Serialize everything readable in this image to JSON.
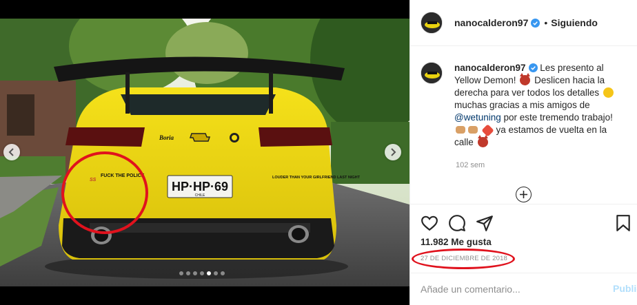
{
  "post": {
    "username": "nanocalderon97",
    "separator": "•",
    "follow_status": "Siguiendo",
    "plate_text": "HP·HP·69",
    "plate_country": "CHILE",
    "badge_text": "SS",
    "decal_left": "FUCK THE POLICE",
    "decal_right": "LOUDER THAN YOUR GIRLFRIEND LAST NIGHT",
    "brand_badge": "Boria",
    "photo_count": 7,
    "active_photo": 5
  },
  "caption": {
    "username": "nanocalderon97",
    "text_1": "Les presento al Yellow Demon!",
    "text_2": "Deslicen hacia la derecha para ver todos los detalles",
    "text_3": "muchas gracias a mis amigos de",
    "mention": "@wetuning",
    "text_4": "por este tremendo trabajo!",
    "text_5": "ya estamos de vuelta en la calle",
    "time": "102 sem",
    "emojis": [
      "smiling-devil",
      "star-struck",
      "fist-bump",
      "fist-bump",
      "collision",
      "smiling-devil"
    ]
  },
  "stats": {
    "likes": "11.982 Me gusta",
    "date": "27 DE DICIEMBRE DE 2018"
  },
  "comment": {
    "placeholder": "Añade un comentario...",
    "post_label": "Publicar"
  },
  "icons": [
    "heart-icon",
    "comment-icon",
    "share-icon",
    "bookmark-icon",
    "plus-circle-icon",
    "verified-icon",
    "chevron-left-icon",
    "chevron-right-icon"
  ],
  "colors": {
    "car_yellow": "#f2dc12",
    "verified_blue": "#3897f0",
    "annotation_red": "#e0121d",
    "publish_disabled": "#b2dffc"
  }
}
